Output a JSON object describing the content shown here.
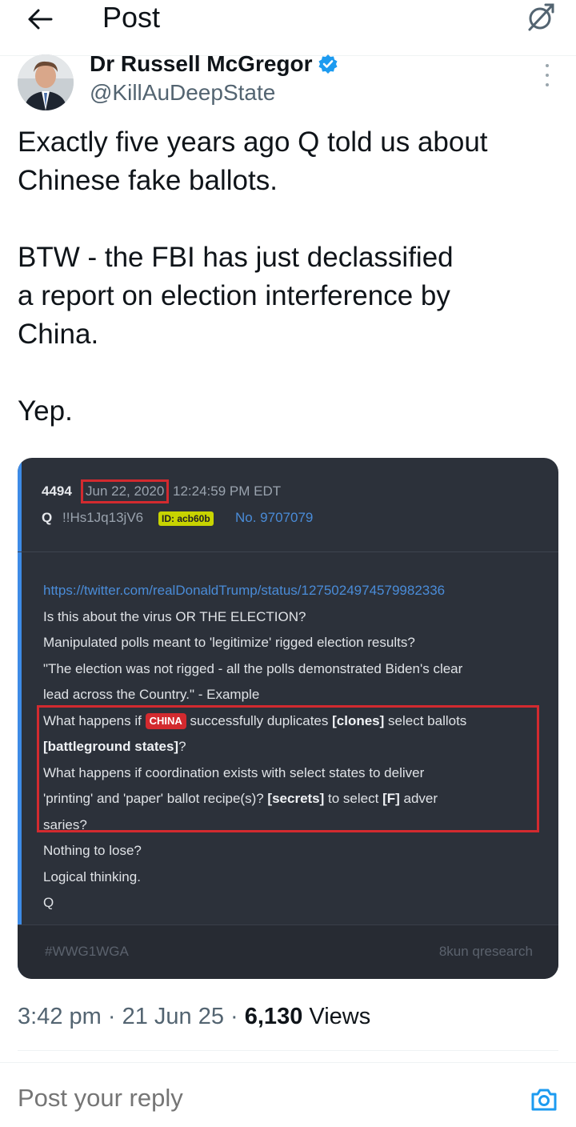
{
  "header": {
    "title": "Post"
  },
  "author": {
    "name": "Dr Russell McGregor",
    "handle": "@KillAuDeepState"
  },
  "post": {
    "text_lines": [
      "Exactly five years ago Q told us about",
      "Chinese fake ballots.",
      "",
      "BTW - the FBI has just declassified",
      "a report on election interference by",
      "China.",
      "",
      "Yep."
    ]
  },
  "embedded": {
    "number": "4494",
    "date": "Jun 22, 2020",
    "time": "12:24:59 PM EDT",
    "q_name": "Q",
    "tripcode": "!!Hs1Jq13jV6",
    "id_badge": "ID: acb60b",
    "post_no": "No. 9707079",
    "link": "https://twitter.com/realDonaldTrump/status/1275024974579982336",
    "line1": "Is this about the virus OR THE ELECTION?",
    "line2": "Manipulated polls meant to 'legitimize' rigged election results?",
    "line3": "\"The election was not rigged - all the polls demonstrated Biden's clear",
    "line4": "lead across the Country.\" - Example",
    "line5_pre": "What happens if ",
    "line5_tag": "CHINA",
    "line5_mid": " successfully duplicates ",
    "line5_bold": "[clones]",
    "line5_post": " select ballots",
    "line6_bold": "[battleground states]",
    "line6_post": "?",
    "line7": "What happens if coordination exists with select states to deliver",
    "line8_pre": "'printing' and 'paper' ballot recipe(s)? ",
    "line8_bold1": "[secrets]",
    "line8_mid": " to select ",
    "line8_bold2": "[F]",
    "line8_post": " adver",
    "line9": "saries?",
    "line10": "Nothing to lose?",
    "line11": "Logical thinking.",
    "line12": "Q",
    "hashtag": "#WWG1WGA",
    "source": "8kun qresearch"
  },
  "meta": {
    "time": "3:42 pm",
    "sep1": " · ",
    "date": "21 Jun 25",
    "sep2": " · ",
    "views_count": "6,130",
    "views_label": " Views"
  },
  "reply": {
    "placeholder": "Post your reply"
  },
  "colors": {
    "accent": "#1d9bf0",
    "highlight": "#d32a2f",
    "card_bg": "#2c313a"
  }
}
